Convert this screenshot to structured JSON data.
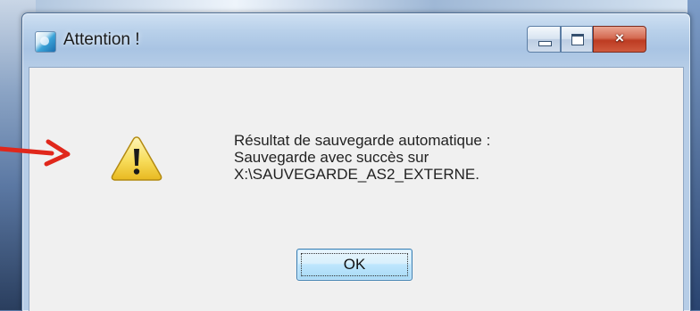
{
  "window": {
    "title": "Attention !",
    "controls": {
      "minimize": "minimize",
      "maximize": "maximize",
      "close": "×"
    }
  },
  "dialog": {
    "icon": "warning-icon",
    "message_lines": [
      "Résultat de sauvegarde automatique :",
      "Sauvegarde avec succès sur",
      "X:\\SAUVEGARDE_AS2_EXTERNE."
    ],
    "ok_label": "OK"
  },
  "annotation": {
    "arrow_color": "#e0271b"
  },
  "colors": {
    "close_button": "#c8462a",
    "warning_fill": "#f7dc5a",
    "dialog_bg": "#f0f0f0"
  }
}
